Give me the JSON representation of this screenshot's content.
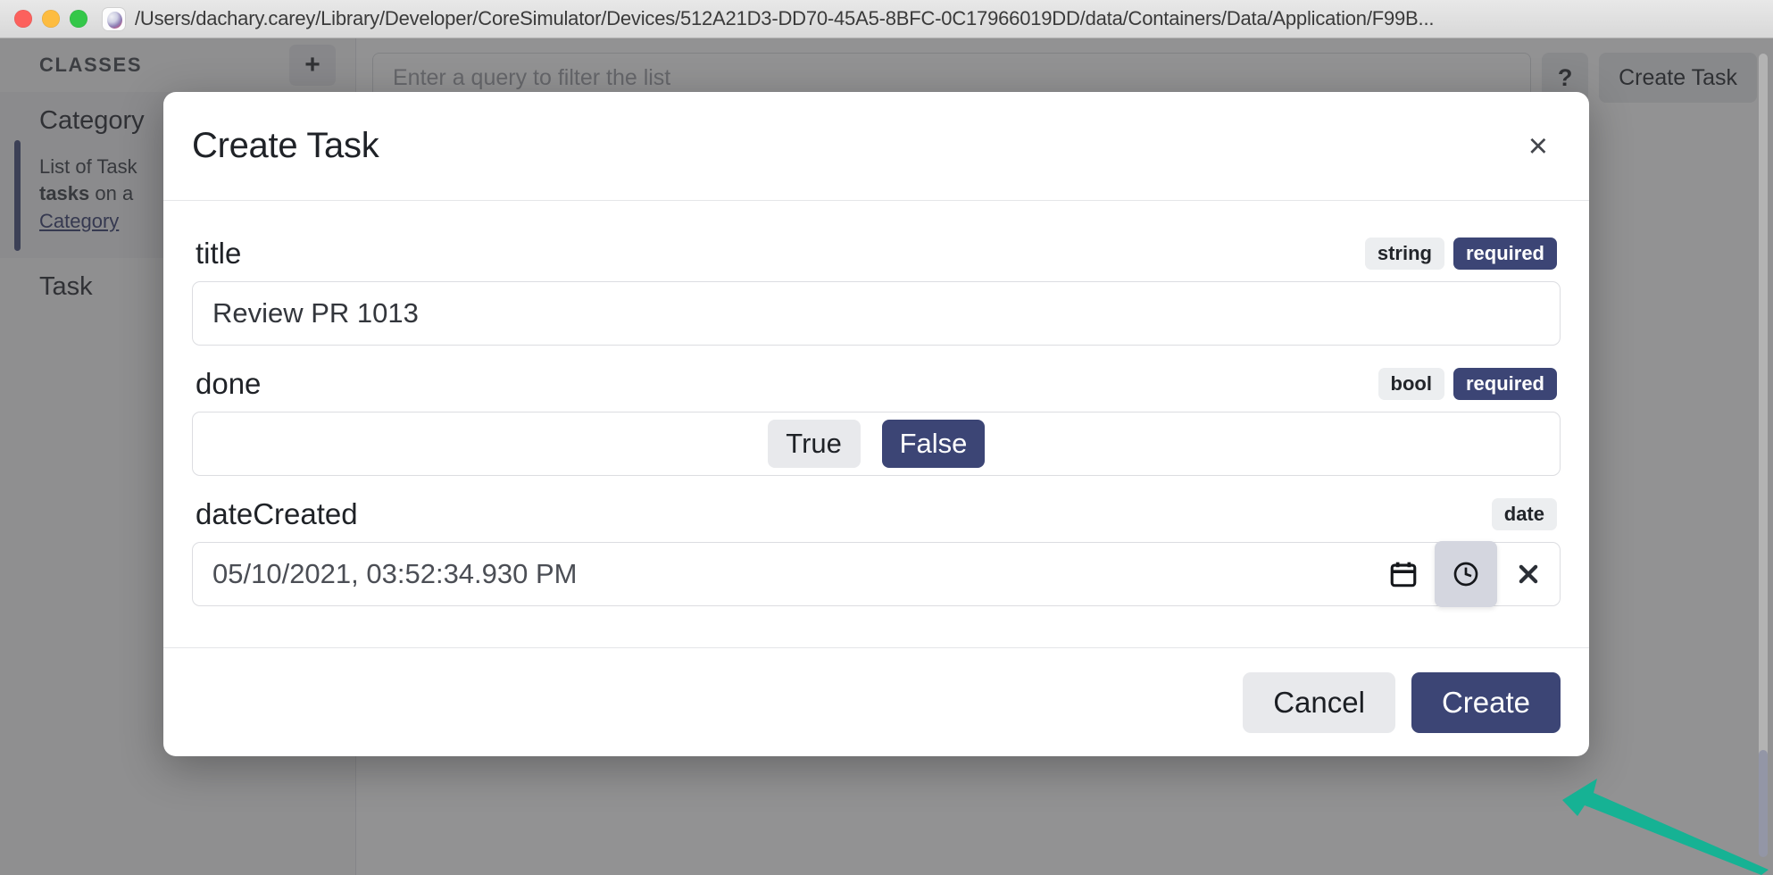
{
  "window": {
    "title": "/Users/dachary.carey/Library/Developer/CoreSimulator/Devices/512A21D3-DD70-45A5-8BFC-0C17966019DD/data/Containers/Data/Application/F99B...",
    "traffic_lights": [
      "close",
      "minimize",
      "zoom"
    ],
    "app_icon": "realm-studio-icon"
  },
  "sidebar": {
    "header_label": "CLASSES",
    "add_button_label": "+",
    "classes": [
      {
        "name": "Category",
        "selected": true,
        "description_prefix": "List of Task",
        "description_bold": "tasks",
        "description_mid": " on a ",
        "description_link": "Category"
      },
      {
        "name": "Task",
        "selected": false
      }
    ]
  },
  "main": {
    "filter_placeholder": "Enter a query to filter the list",
    "help_label": "?",
    "create_task_label": "Create Task"
  },
  "modal": {
    "title": "Create Task",
    "close_label": "×",
    "fields": [
      {
        "label": "title",
        "type_badge": "string",
        "required_badge": "required",
        "value": "Review PR 1013",
        "kind": "text"
      },
      {
        "label": "done",
        "type_badge": "bool",
        "required_badge": "required",
        "kind": "bool",
        "options": [
          "True",
          "False"
        ],
        "selected": "False"
      },
      {
        "label": "dateCreated",
        "type_badge": "date",
        "required_badge": "",
        "kind": "date",
        "value": "05/10/2021, 03:52:34.930 PM",
        "actions": [
          "calendar-icon",
          "clock-icon",
          "clear-icon"
        ]
      }
    ],
    "cancel_label": "Cancel",
    "create_label": "Create"
  },
  "annotation": {
    "arrow_color": "#16b294",
    "points_to": "create-button"
  },
  "colors": {
    "accent": "#3c4575",
    "badge_type_bg": "#eceef0",
    "scrim": "rgba(60,60,62,0.56)",
    "arrow": "#16b294"
  }
}
